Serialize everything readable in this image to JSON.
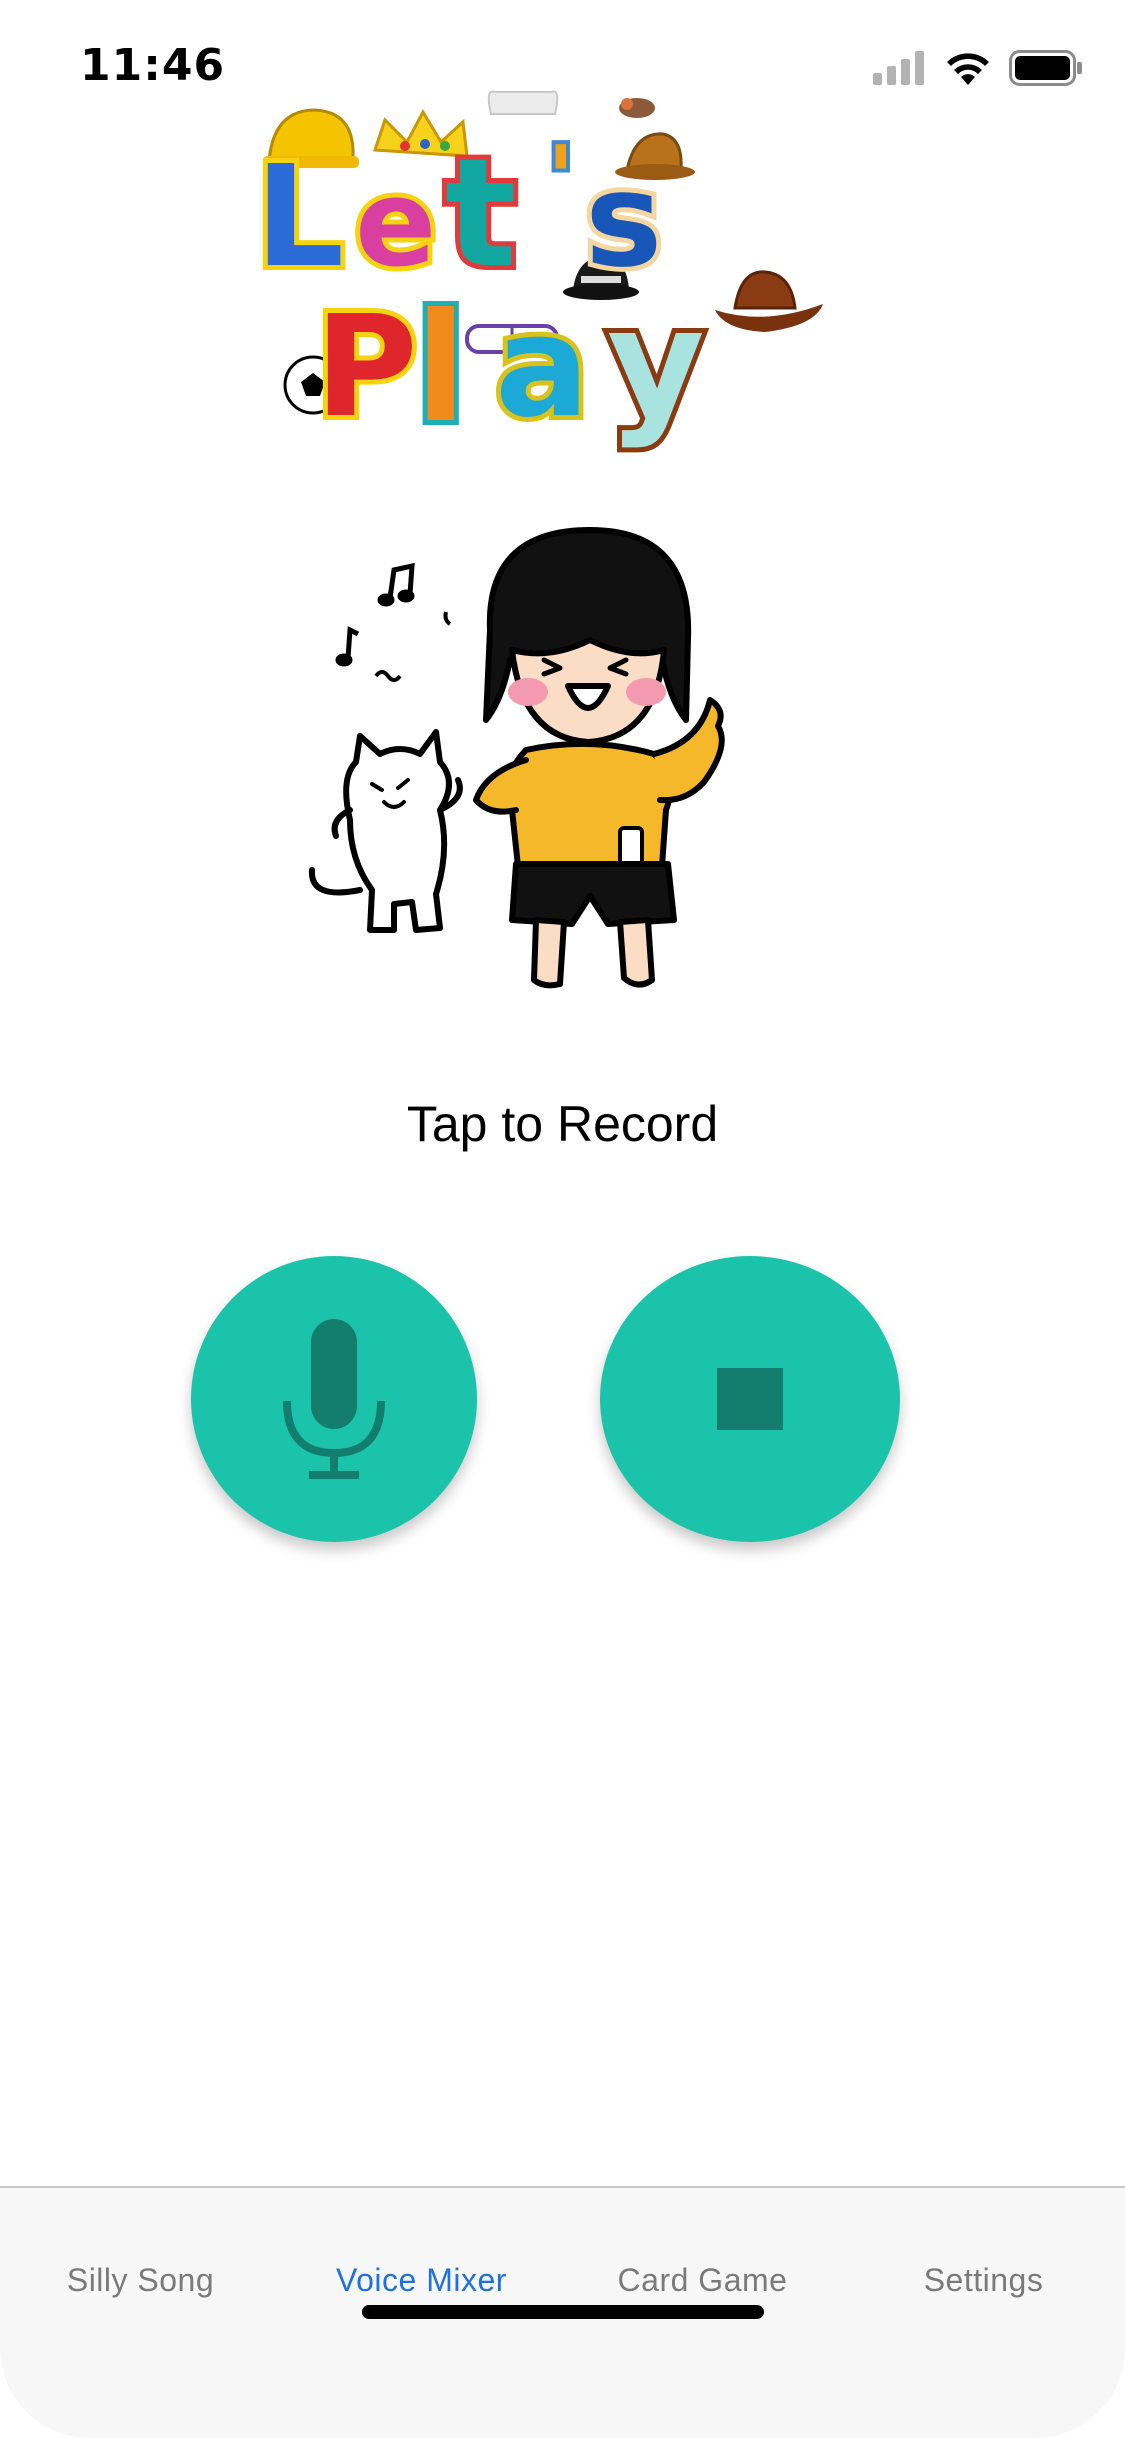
{
  "status_bar": {
    "time": "11:46",
    "icons": [
      "cellular-signal-icon",
      "wifi-icon",
      "battery-icon"
    ]
  },
  "logo": {
    "line1": [
      "L",
      "e",
      "t",
      "'",
      "s"
    ],
    "line2": [
      "P",
      "l",
      "a",
      "y"
    ]
  },
  "illustration": {
    "description_icon": "dancing-girl-and-cat-illustration"
  },
  "main": {
    "caption": "Tap to Record",
    "record_icon": "microphone-icon",
    "stop_icon": "stop-icon"
  },
  "tab_bar": {
    "tabs": [
      {
        "label": "Silly Song",
        "active": false
      },
      {
        "label": "Voice Mixer",
        "active": true
      },
      {
        "label": "Card Game",
        "active": false
      },
      {
        "label": "Settings",
        "active": false
      }
    ]
  },
  "colors": {
    "accent": "#1cc3ab",
    "accent_dark": "#137e6d",
    "tab_active": "#1e72e0",
    "tab_inactive": "#7a7a7a",
    "tab_bar_bg": "#f7f7f7"
  }
}
